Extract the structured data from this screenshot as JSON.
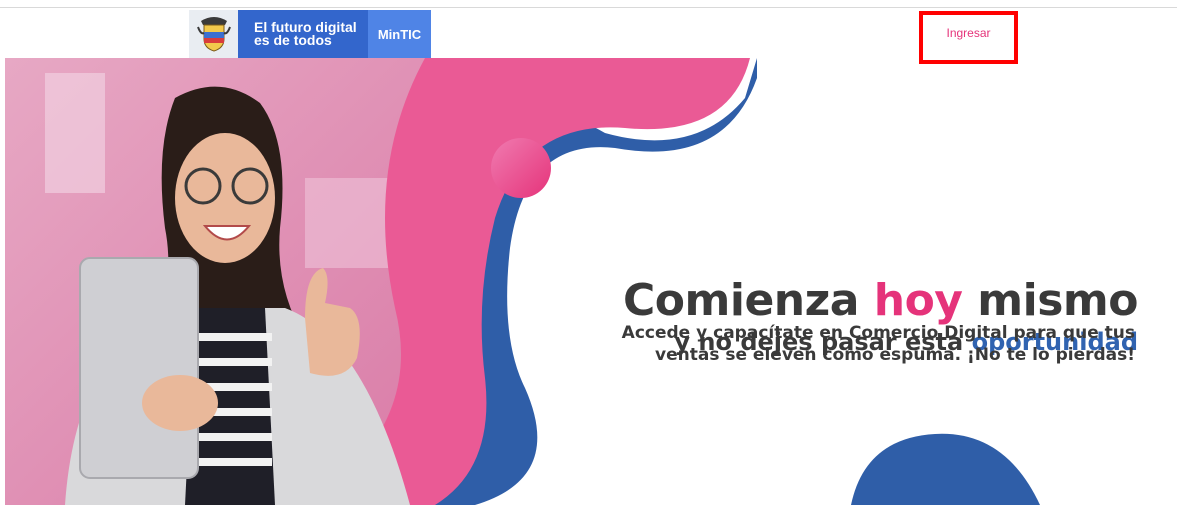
{
  "header": {
    "logo_line1": "El futuro digital",
    "logo_line2": "es de todos",
    "logo_badge": "MinTIC",
    "login_label": "Ingresar"
  },
  "hero": {
    "headline_part1": "Comienza ",
    "headline_highlight": "hoy",
    "headline_part2": " mismo",
    "subheadline_part1": "y no dejes pasar esta ",
    "subheadline_highlight": "oportunidad",
    "description": "Accede y capacítate en Comercio Digital para que tus ventas se eleven como espuma. ¡No te lo pierdas!"
  },
  "colors": {
    "pink": "#e5337a",
    "blue": "#2f5ea8",
    "gov_blue": "#3366cc",
    "highlight_border": "#ff0000"
  },
  "icons": {
    "shield": "colombia-coat-of-arms-icon"
  }
}
